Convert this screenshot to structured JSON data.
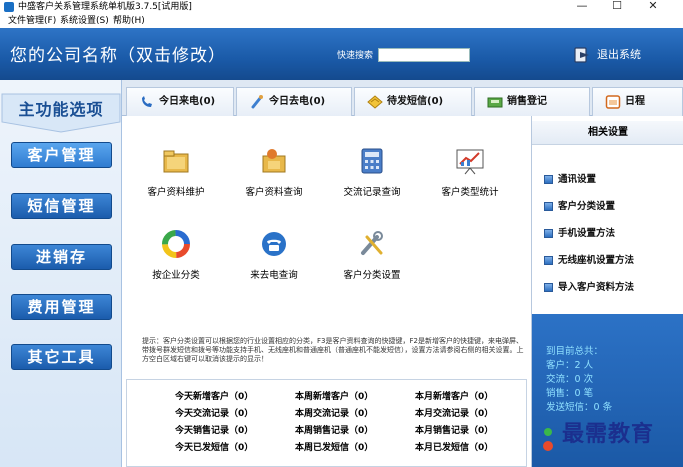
{
  "window": {
    "title": "中盛客户关系管理系统单机版3.7.5[试用版]",
    "minimize": "—",
    "maximize": "☐",
    "close": "✕"
  },
  "menu": [
    "文件管理(F)",
    "系统设置(S)",
    "帮助(H)"
  ],
  "header": {
    "company_name": "您的公司名称（双击修改）",
    "search_label": "快速搜索",
    "search_value": "",
    "logout_label": "退出系统"
  },
  "nav": {
    "section_title": "主功能选项",
    "buttons": [
      "客户管理",
      "短信管理",
      "进销存",
      "费用管理",
      "其它工具"
    ],
    "active_index": 0
  },
  "tabs": [
    {
      "label": "今日来电(0)",
      "icon": "phone-incoming-icon"
    },
    {
      "label": "今日去电(0)",
      "icon": "phone-outgoing-icon"
    },
    {
      "label": "待发短信(0)",
      "icon": "envelope-icon"
    },
    {
      "label": "销售登记",
      "icon": "cash-register-icon"
    },
    {
      "label": "日程",
      "icon": "calendar-icon"
    }
  ],
  "features": [
    {
      "label": "客户资料维护",
      "icon": "folders-icon"
    },
    {
      "label": "客户资料查询",
      "icon": "folder-search-icon"
    },
    {
      "label": "交流记录查询",
      "icon": "calculator-icon"
    },
    {
      "label": "客户类型统计",
      "icon": "presentation-chart-icon"
    },
    {
      "label": "按企业分类",
      "icon": "color-ring-icon"
    },
    {
      "label": "来去电查询",
      "icon": "telephone-icon"
    },
    {
      "label": "客户分类设置",
      "icon": "tools-icon"
    }
  ],
  "hint": "提示：客户分类设置可以根据您的行业设置相应的分类，F3是客户资料查询的快捷键，F2是新增客户的快捷键，来电弹屏、带拨号群发短信和拨号等功能支持手机、无线座机和普通座机（普通座机不能发短信），设置方法请参阅右侧的相关设置。上方空白区域右键可以取消该提示的显示！",
  "stats": {
    "rows": [
      [
        "今天新增客户（0）",
        "本周新增客户（0）",
        "本月新增客户（0）"
      ],
      [
        "今天交流记录（0）",
        "本周交流记录（0）",
        "本月交流记录（0）"
      ],
      [
        "今天销售记录（0）",
        "本周销售记录（0）",
        "本月销售记录（0）"
      ],
      [
        "今天已发短信（0）",
        "本周已发短信（0）",
        "本月已发短信（0）"
      ]
    ]
  },
  "right_panel": {
    "title": "相关设置",
    "items": [
      "通讯设置",
      "客户分类设置",
      "手机设置方法",
      "无线座机设置方法",
      "导入客户资料方法"
    ],
    "summary_title": "到目前总共：",
    "summary": [
      "客户：2 人",
      "交流：0 次",
      "销售：0 笔",
      "发送短信：0 条"
    ]
  },
  "watermark": "最需教育",
  "colors": {
    "header_blue": "#1a5aa8",
    "nav_button": "#1b5cac",
    "summary_text": "#8fe0ff"
  }
}
